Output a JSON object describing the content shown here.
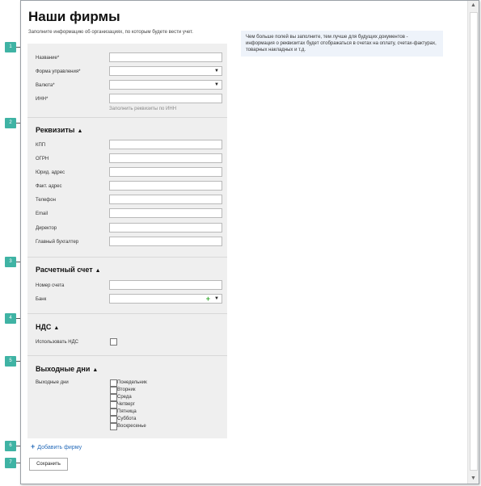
{
  "header": {
    "title": "Наши фирмы",
    "subtitle": "Заполните информацию об организациях, по которым будете вести учет."
  },
  "info": "Чем больше полей вы заполните, тем лучше для будущих документов - информация о реквизитах будет отображаться в счетах на оплату, счетах-фактурах, товарных накладных и т.д.",
  "main": {
    "name_label": "Название*",
    "form_label": "Форма управления*",
    "currency_label": "Валюта*",
    "inn_label": "ИНН*",
    "fill_by_inn": "Заполнить реквизиты по ИНН"
  },
  "requisites": {
    "title": "Реквизиты",
    "fields": [
      "КПП",
      "ОГРН",
      "Юрид. адрес",
      "Факт. адрес",
      "Телефон",
      "Email",
      "Директор",
      "Главный бухгалтер"
    ]
  },
  "account": {
    "title": "Расчетный счет",
    "number_label": "Номер счета",
    "bank_label": "Банк"
  },
  "vat": {
    "title": "НДС",
    "use_label": "Использовать НДС"
  },
  "weekends": {
    "title": "Выходные дни",
    "label": "Выходные дни",
    "days": [
      "Понедельник",
      "Вторник",
      "Среда",
      "Четверг",
      "Пятница",
      "Суббота",
      "Воскресенье"
    ]
  },
  "actions": {
    "add_company": "Добавить фирму",
    "save": "Сохранить"
  },
  "callouts": [
    "1",
    "2",
    "3",
    "4",
    "5",
    "6",
    "7"
  ],
  "icons": {
    "chevron": "chevron-up-icon",
    "dropdown": "chevron-down-icon",
    "plus": "plus-icon"
  },
  "colors": {
    "badge": "#3fb3a4",
    "link": "#2a6ebb",
    "plus": "#3aaa35",
    "info_bg": "#eef3fa",
    "panel_bg": "#efefef"
  }
}
